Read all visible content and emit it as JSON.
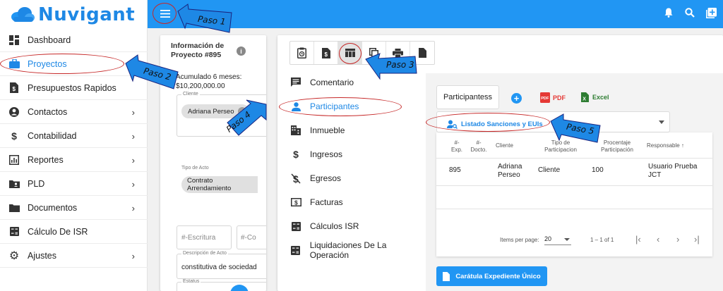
{
  "brand": {
    "name": "Nuvigant"
  },
  "sidebar": {
    "items": [
      {
        "label": "Dashboard",
        "icon": "dashboard-icon"
      },
      {
        "label": "Proyectos",
        "icon": "briefcase-icon"
      },
      {
        "label": "Presupuestos Rapidos",
        "icon": "receipt-icon"
      },
      {
        "label": "Contactos",
        "icon": "person-circle-icon"
      },
      {
        "label": "Contabilidad",
        "icon": "dollar-icon"
      },
      {
        "label": "Reportes",
        "icon": "chart-icon"
      },
      {
        "label": "PLD",
        "icon": "folder-account-icon"
      },
      {
        "label": "Documentos",
        "icon": "folder-icon"
      },
      {
        "label": "Cálculo De ISR",
        "icon": "calculator-icon"
      },
      {
        "label": "Ajustes",
        "icon": "gear-icon"
      }
    ]
  },
  "project": {
    "title": "Información de Proyecto #895",
    "accum": "Acumulado 6 meses: $10,200,000.00",
    "client_label": "Cliente",
    "client_chip": "Adriana Perseo",
    "tipo_label": "Tipo de Acto",
    "tipo_value": "Contrato Arrendamiento",
    "escritura_placeholder": "#-Escritura",
    "co_placeholder": "#-Co",
    "desc_label": "Descripción de Acto",
    "desc_value": "constitutiva de sociedad",
    "estatus_label": "Estatus"
  },
  "menu": {
    "items": [
      {
        "label": "Comentario",
        "icon": "comment-icon"
      },
      {
        "label": "Participantes",
        "icon": "person-icon"
      },
      {
        "label": "Inmueble",
        "icon": "building-icon"
      },
      {
        "label": "Ingresos",
        "icon": "dollar-icon"
      },
      {
        "label": "Egresos",
        "icon": "money-off-icon"
      },
      {
        "label": "Facturas",
        "icon": "invoice-icon"
      },
      {
        "label": "Cálculos ISR",
        "icon": "calculator-icon"
      },
      {
        "label": "Liquidaciones De La Operación",
        "icon": "calculator-icon"
      }
    ]
  },
  "participants": {
    "tab_label": "Participantess",
    "pdf_label": "PDF",
    "excel_label": "Excel",
    "listado_label": "Listado Sanciones y EUIs",
    "headers": {
      "exp": "#-Exp.",
      "docto": "#-Docto.",
      "cliente": "Cliente",
      "tipo": "Tipo de Participacion",
      "porcentaje": "Procentaje Participación",
      "responsable": "Responsable ↑"
    },
    "rows": [
      {
        "exp": "895",
        "docto": "",
        "cliente": "Adriana Perseo",
        "tipo": "Cliente",
        "porcentaje": "100",
        "responsable": "Usuario Prueba JCT"
      }
    ],
    "paginator": {
      "items_label": "Items per page:",
      "page_size": "20",
      "range": "1 – 1 of 1"
    },
    "caratula_label": "Carátula Expediente Único"
  },
  "annotations": {
    "paso1": "Paso 1",
    "paso2": "Paso 2",
    "paso3": "Paso 3",
    "paso4": "Paso 4",
    "paso5": "Paso 5"
  },
  "colors": {
    "primary": "#2196f3",
    "annotation_red": "#c62828",
    "arrow_fill": "#1e88e5",
    "pdf_red": "#e53935",
    "excel_green": "#2e7d32"
  }
}
